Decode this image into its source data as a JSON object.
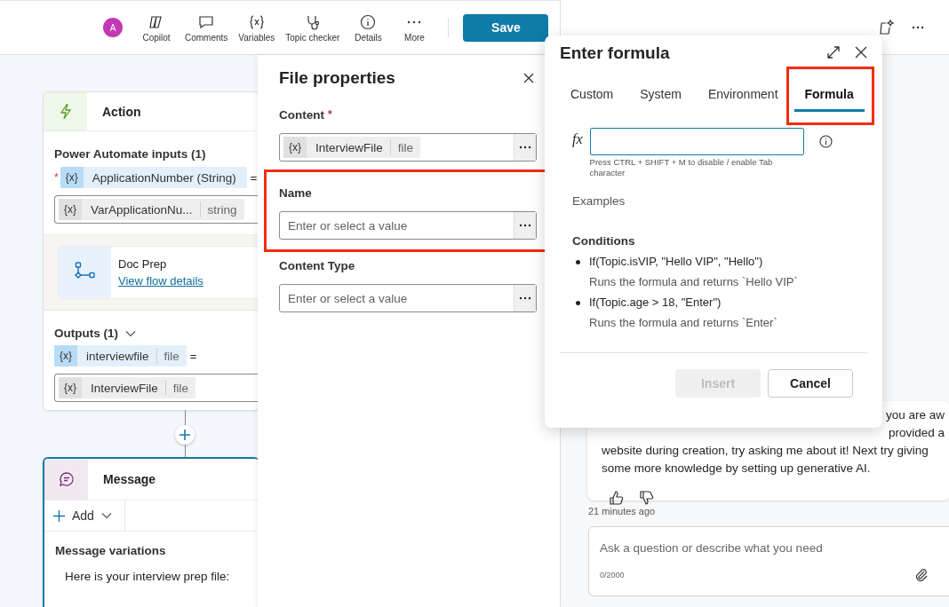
{
  "toolbar": {
    "avatar": "A",
    "items": [
      {
        "kind": "copilot",
        "label": "Copilot"
      },
      {
        "kind": "comments",
        "label": "Comments"
      },
      {
        "kind": "variables",
        "label": "Variables"
      },
      {
        "kind": "checker",
        "label": "Topic checker"
      },
      {
        "kind": "details",
        "label": "Details"
      },
      {
        "kind": "more",
        "label": "More"
      }
    ],
    "save": "Save"
  },
  "canvas": {
    "action_node": {
      "title": "Action",
      "inputs_heading": "Power Automate inputs (1)",
      "input": {
        "required_mark": "*",
        "token": "{x}",
        "name": "ApplicationNumber (String)",
        "operator": "=",
        "value": {
          "token": "{x}",
          "name": "VarApplicationNu...",
          "type": "string"
        }
      },
      "flow": {
        "name": "Doc Prep",
        "link": "View flow details"
      },
      "outputs_heading": "Outputs (1)",
      "outputs_expanded": true,
      "output": {
        "token": "{x}",
        "name": "interviewfile",
        "type": "file",
        "operator": "=",
        "value": {
          "token": "{x}",
          "name": "InterviewFile",
          "type": "file"
        }
      }
    },
    "message_node": {
      "title": "Message",
      "add": "Add",
      "heading": "Message variations",
      "text": "Here is your interview prep file:"
    }
  },
  "file_properties": {
    "title": "File properties",
    "fields": [
      {
        "kind": "token",
        "label": "Content",
        "required_mark": "*",
        "highlighted": false,
        "value": {
          "token": "{x}",
          "name": "InterviewFile",
          "type": "file"
        }
      },
      {
        "kind": "input",
        "label": "Name",
        "highlighted": true,
        "placeholder": "Enter or select a value"
      },
      {
        "kind": "input",
        "label": "Content Type",
        "highlighted": false,
        "placeholder": "Enter or select a value"
      }
    ]
  },
  "formula_dialog": {
    "title": "Enter formula",
    "tabs": [
      {
        "label": "Custom",
        "selected": false,
        "highlighted": false
      },
      {
        "label": "System",
        "selected": false,
        "highlighted": false
      },
      {
        "label": "Environment",
        "selected": false,
        "highlighted": false
      },
      {
        "label": "Formula",
        "selected": true,
        "highlighted": true
      }
    ],
    "fx": "fx",
    "hint": "Press CTRL + SHIFT + M to disable / enable Tab character",
    "examples_heading": "Examples",
    "conditions_heading": "Conditions",
    "conditions": [
      {
        "formula": "If(Topic.isVIP, \"Hello VIP\", \"Hello\")",
        "description": "Runs the formula and returns `Hello VIP`"
      },
      {
        "formula": "If(Topic.age > 18, \"Enter\")",
        "description": "Runs the formula and returns `Enter`"
      }
    ],
    "buttons": [
      {
        "label": "Insert",
        "disabled": true
      },
      {
        "label": "Cancel",
        "disabled": false
      }
    ]
  },
  "copilot_pane": {
    "message_lines": [
      "you are aw",
      "provided a",
      "website during creation, try asking me about it! Next try giving",
      "some more knowledge by setting up generative AI."
    ],
    "time": "21 minutes ago",
    "input_placeholder": "Ask a question or describe what you need",
    "counter": "0/2000"
  }
}
